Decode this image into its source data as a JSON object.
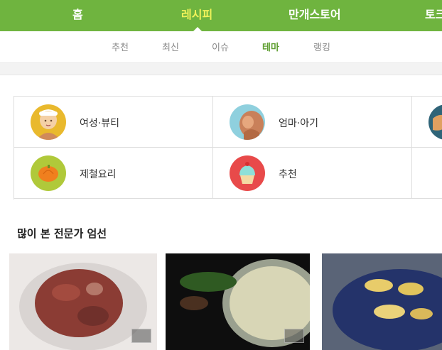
{
  "topnav": {
    "items": [
      {
        "label": "홈"
      },
      {
        "label": "레시피"
      },
      {
        "label": "만개스토어"
      },
      {
        "label": "토크"
      }
    ],
    "active_index": 1
  },
  "subnav": {
    "items": [
      {
        "label": "추천"
      },
      {
        "label": "최신"
      },
      {
        "label": "이슈"
      },
      {
        "label": "테마"
      },
      {
        "label": "랭킹"
      }
    ],
    "active_index": 3
  },
  "themes": [
    {
      "label": "여성·뷰티",
      "icon": "beauty-woman-icon"
    },
    {
      "label": "엄마·아기",
      "icon": "mother-baby-icon"
    },
    {
      "label": "",
      "icon": "partial-theme-icon"
    },
    {
      "label": "제철요리",
      "icon": "pumpkin-icon"
    },
    {
      "label": "추천",
      "icon": "cupcake-icon"
    }
  ],
  "section": {
    "title": "많이 본 전문가 엄선"
  },
  "colors": {
    "brand_green": "#6fb43f",
    "active_top": "#f1f25a",
    "active_sub": "#5e9e2f"
  }
}
